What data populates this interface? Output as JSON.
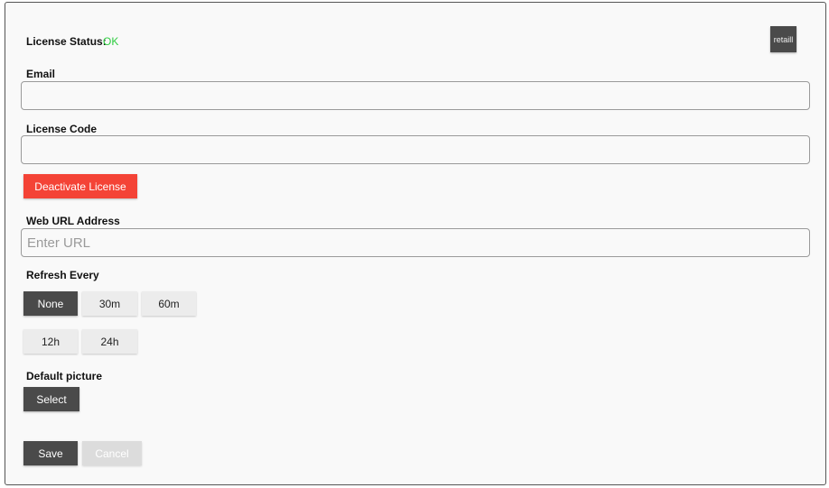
{
  "license_status": {
    "label": "License Status:",
    "value": "OK"
  },
  "logo": {
    "text": "retaill"
  },
  "email": {
    "label": "Email",
    "value": "",
    "placeholder": ""
  },
  "license_code": {
    "label": "License Code",
    "value": "",
    "placeholder": ""
  },
  "deactivate_button": "Deactivate License",
  "web_url": {
    "label": "Web URL Address",
    "value": "",
    "placeholder": "Enter URL"
  },
  "refresh": {
    "label": "Refresh Every",
    "selected": "None",
    "options": [
      "None",
      "30m",
      "60m",
      "12h",
      "24h"
    ]
  },
  "default_picture": {
    "label": "Default picture",
    "button": "Select"
  },
  "footer": {
    "save": "Save",
    "cancel": "Cancel"
  },
  "colors": {
    "status_ok": "#2ecc40",
    "danger": "#f44336",
    "dark_button": "#4a4a4a",
    "light_button": "#ececec"
  }
}
